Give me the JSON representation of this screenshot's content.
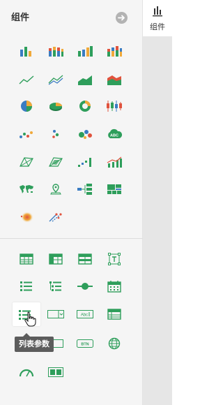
{
  "panel": {
    "title": "组件",
    "collapse_icon": "arrow-right-circle-icon"
  },
  "rightbar": {
    "tab_label": "组件",
    "tab_icon": "bar-chart-icon"
  },
  "colors": {
    "green": "#2e9e5b",
    "blue": "#3a7cc2",
    "orange": "#f0a93a",
    "red": "#e0533d",
    "panel_bg": "#f5f5f5"
  },
  "chart_components": [
    "bar-chart-icon",
    "stacked-bar-chart-icon",
    "bar-line-chart-icon",
    "stacked-bar-chart-alt-icon",
    "line-chart-icon",
    "multi-line-chart-icon",
    "area-chart-icon",
    "stacked-area-chart-icon",
    "pie-chart-icon",
    "pie-3d-chart-icon",
    "donut-chart-icon",
    "candlestick-chart-icon",
    "scatter-chart-icon",
    "bubble-small-chart-icon",
    "bubble-chart-icon",
    "word-cloud-icon",
    "radar-chart-icon",
    "multi-radar-chart-icon",
    "step-chart-icon",
    "bar-line-trend-chart-icon",
    "world-map-icon",
    "location-map-icon",
    "tree-diagram-icon",
    "treemap-icon",
    "heatmap-icon",
    "flow-map-icon"
  ],
  "tool_components": [
    "table-icon",
    "cross-table-icon",
    "grouped-table-icon",
    "text-box-icon",
    "list-icon",
    "tree-list-icon",
    "slider-icon",
    "calendar-icon",
    "list-param-icon",
    "dropdown-icon",
    "text-input-icon",
    "data-table-icon",
    "hidden-param-icon",
    "param-box-icon",
    "button-icon",
    "web-icon",
    "gauge-icon",
    "tab-panel-icon"
  ],
  "tooltip": {
    "text": "列表参数"
  }
}
